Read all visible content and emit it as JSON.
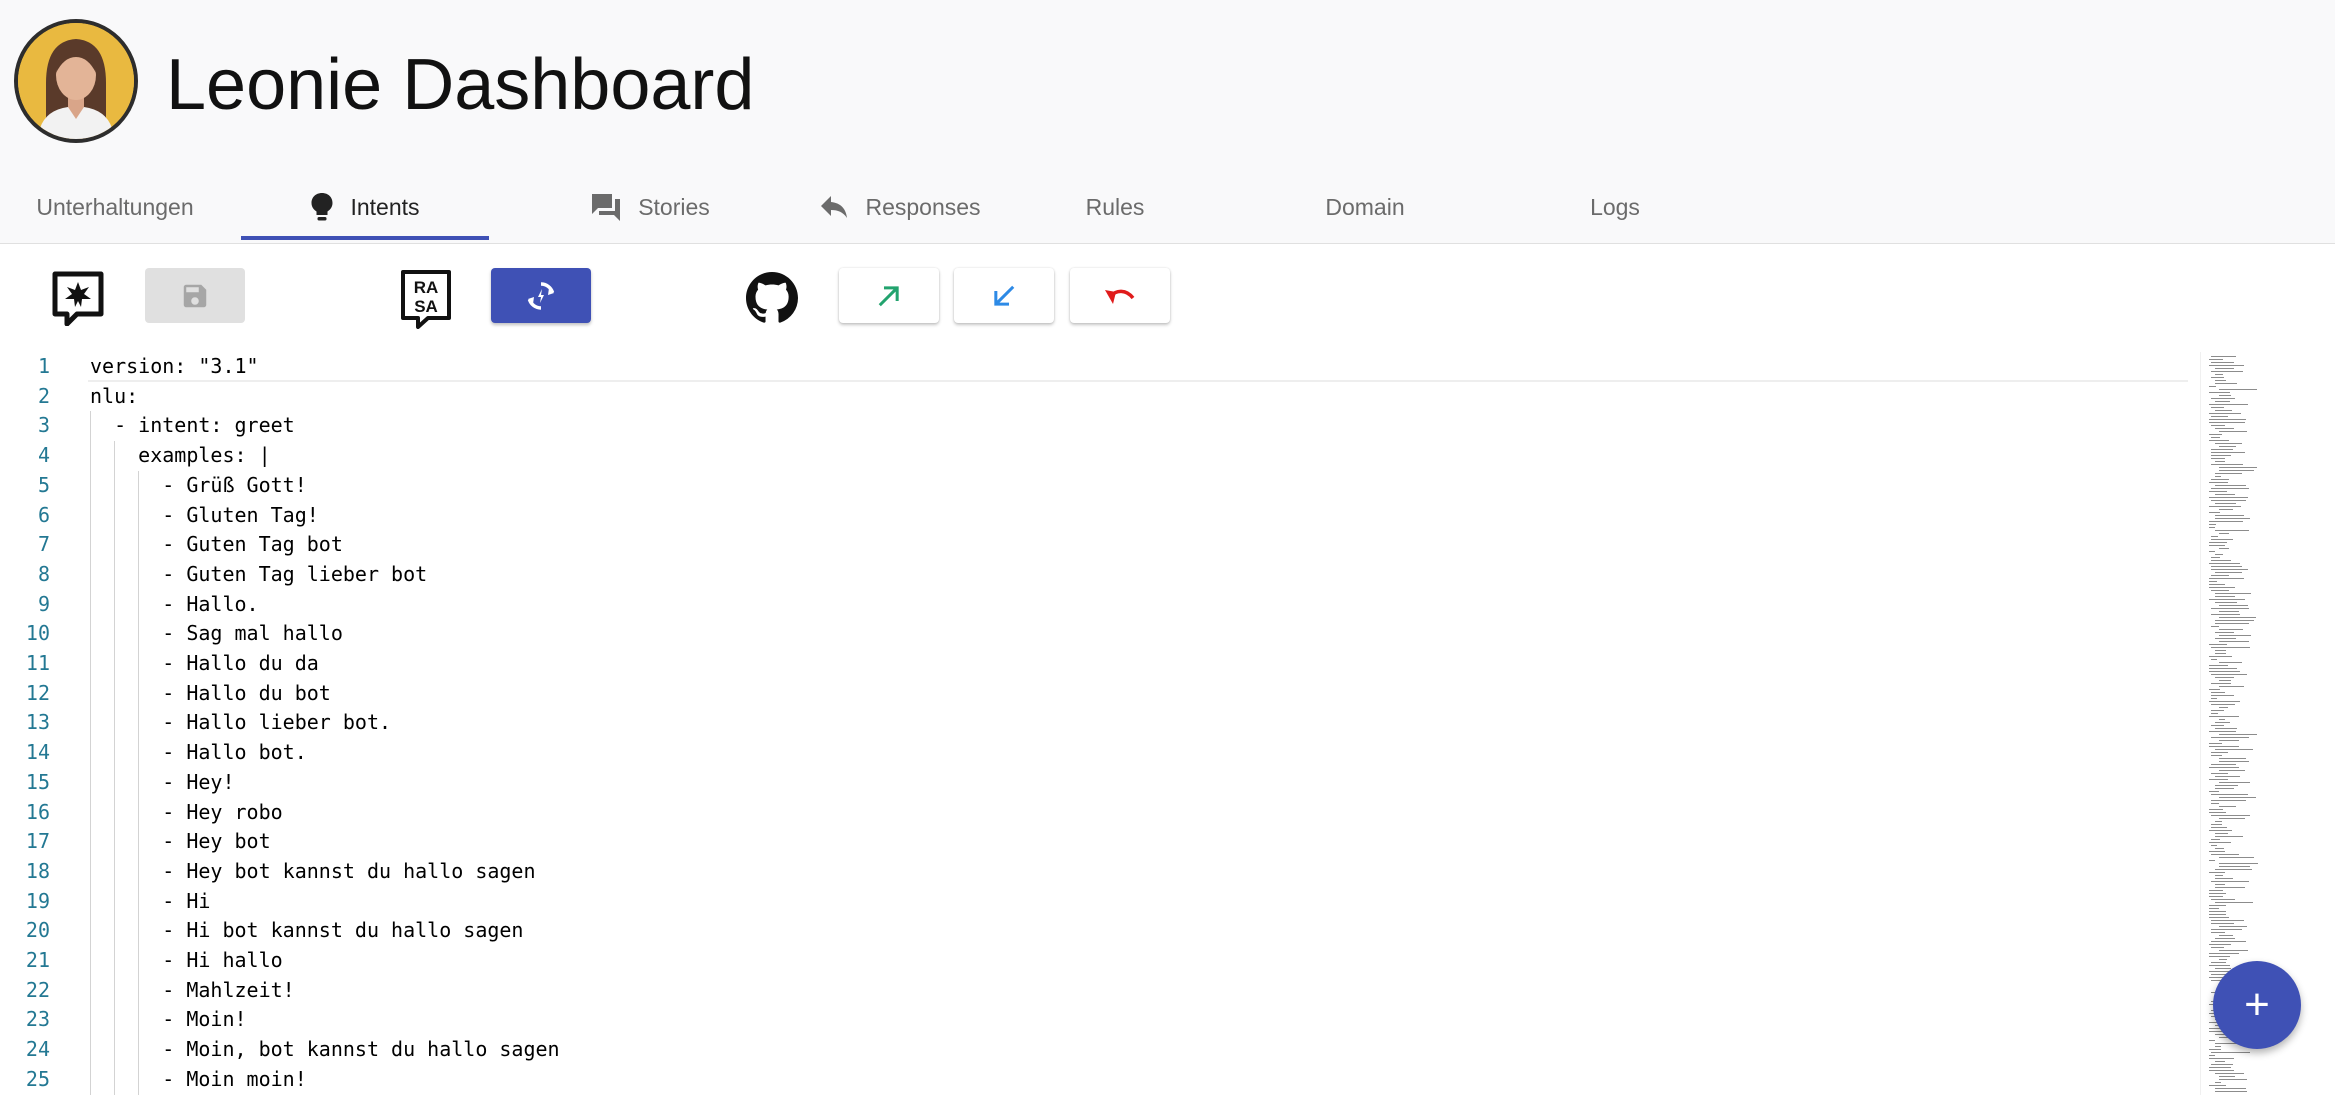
{
  "app": {
    "title": "Leonie Dashboard"
  },
  "tabs": [
    {
      "label": "Unterhaltungen",
      "icon": "",
      "active": false
    },
    {
      "label": "Intents",
      "icon": "lightbulb-icon",
      "active": true
    },
    {
      "label": "Stories",
      "icon": "forum-icon",
      "active": false
    },
    {
      "label": "Responses",
      "icon": "reply-icon",
      "active": false
    },
    {
      "label": "Rules",
      "icon": "",
      "active": false
    },
    {
      "label": "Domain",
      "icon": "",
      "active": false
    },
    {
      "label": "Logs",
      "icon": "",
      "active": false
    }
  ],
  "toolbar": {
    "icons": [
      "rasa-x-icon",
      "save-icon",
      "rasa-icon",
      "train-icon",
      "github-icon",
      "export-arrow-icon",
      "import-arrow-icon",
      "undo-icon"
    ],
    "colors": {
      "primary": "#3f51b5",
      "export": "#22a36e",
      "import": "#2d8ae6",
      "undo": "#e01b1b",
      "disabled": "#e0e0e0"
    }
  },
  "editor": {
    "lines": [
      {
        "n": "1",
        "text": "version: \"3.1\""
      },
      {
        "n": "2",
        "text": "nlu:"
      },
      {
        "n": "3",
        "text": "  - intent: greet"
      },
      {
        "n": "4",
        "text": "    examples: |"
      },
      {
        "n": "5",
        "text": "      - Grüß Gott!"
      },
      {
        "n": "6",
        "text": "      - Gluten Tag!"
      },
      {
        "n": "7",
        "text": "      - Guten Tag bot"
      },
      {
        "n": "8",
        "text": "      - Guten Tag lieber bot"
      },
      {
        "n": "9",
        "text": "      - Hallo."
      },
      {
        "n": "10",
        "text": "      - Sag mal hallo"
      },
      {
        "n": "11",
        "text": "      - Hallo du da"
      },
      {
        "n": "12",
        "text": "      - Hallo du bot"
      },
      {
        "n": "13",
        "text": "      - Hallo lieber bot."
      },
      {
        "n": "14",
        "text": "      - Hallo bot."
      },
      {
        "n": "15",
        "text": "      - Hey!"
      },
      {
        "n": "16",
        "text": "      - Hey robo"
      },
      {
        "n": "17",
        "text": "      - Hey bot"
      },
      {
        "n": "18",
        "text": "      - Hey bot kannst du hallo sagen"
      },
      {
        "n": "19",
        "text": "      - Hi"
      },
      {
        "n": "20",
        "text": "      - Hi bot kannst du hallo sagen"
      },
      {
        "n": "21",
        "text": "      - Hi hallo"
      },
      {
        "n": "22",
        "text": "      - Mahlzeit!"
      },
      {
        "n": "23",
        "text": "      - Moin!"
      },
      {
        "n": "24",
        "text": "      - Moin, bot kannst du hallo sagen"
      },
      {
        "n": "25",
        "text": "      - Moin moin!"
      }
    ]
  },
  "fab": {
    "label": "+"
  }
}
